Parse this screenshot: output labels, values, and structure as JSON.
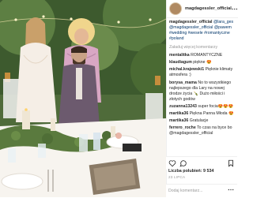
{
  "header": {
    "username": "magdagessler_official"
  },
  "caption": {
    "username": "magdagessler_official",
    "text_1": "@lara_ges",
    "text_2": "@magdagessler_official",
    "text_3": "@pawem",
    "tags": "#wedding #wesele #romantyczne #poland"
  },
  "view_more_label": "Załaduj więcej komentarzy",
  "comments": [
    {
      "username": "mentalitka",
      "text": "ROMANTYCZNE"
    },
    {
      "username": "klaudiagum",
      "text": "piękne 😍"
    },
    {
      "username": "michal.krajewski1",
      "text": "Pięknie klimaty atmosfera :)"
    },
    {
      "username": "borysa_mama",
      "text": "No to wszystkiego najlepszego dla Lary na nowej drodze życia 🍾 Dużo miłości i złotych godów"
    },
    {
      "username": "zuzanna13243",
      "text": "super focia😍😍😍"
    },
    {
      "username": "martika36",
      "text": "Piękna Panna Młoda 😍"
    },
    {
      "username": "martika36",
      "text": "Gratulacje"
    },
    {
      "username": "ferrero_roche",
      "text": "To czas na byce bo @magdagessler_official"
    }
  ],
  "likes_label": "Liczba polubień: 9 534",
  "date_label": "23 LIPCA",
  "add_comment_placeholder": "Dodaj komentarz...",
  "colors": {
    "link": "#003569",
    "muted": "#999999",
    "text": "#262626"
  }
}
